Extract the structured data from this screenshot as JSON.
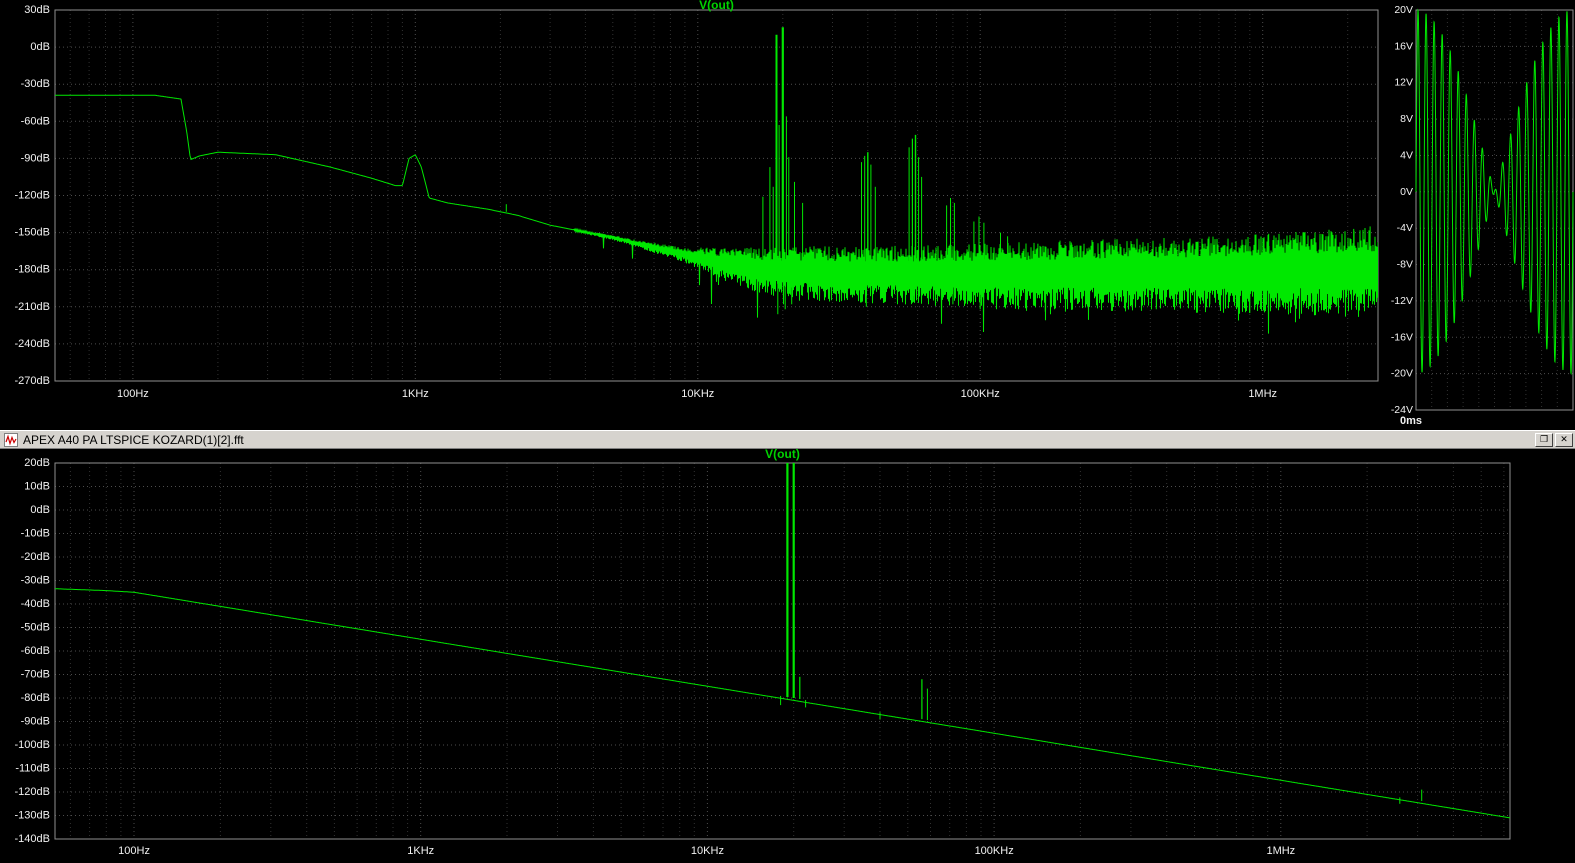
{
  "window": {
    "title": "APEX A40 PA LTSPICE KOZARD(1)[2].fft",
    "icon": "waveform-icon",
    "buttons": [
      {
        "name": "restore-button",
        "glyph": "❐"
      },
      {
        "name": "close-button",
        "glyph": "✕"
      }
    ]
  },
  "colors": {
    "background": "#000000",
    "trace": "#00e800",
    "title": "#00d400",
    "text": "#f2f2f2",
    "grid": "#4d4d4d",
    "grid_minor": "#323232",
    "frame": "#8f8f8f",
    "titlebar_bg": "#d6d3ce",
    "titlebar_text": "#000000",
    "icon_trace": "#cc0000"
  },
  "chart_data": [
    {
      "id": "top_fft",
      "type": "line",
      "title": "V(out)",
      "x_axis": {
        "scale": "log",
        "unit": "Hz",
        "min": 53,
        "max": 2560000,
        "ticks": [
          {
            "f": 100,
            "label": "100Hz"
          },
          {
            "f": 1000,
            "label": "1KHz"
          },
          {
            "f": 10000,
            "label": "10KHz"
          },
          {
            "f": 100000,
            "label": "100KHz"
          },
          {
            "f": 1000000,
            "label": "1MHz"
          }
        ]
      },
      "y_axis": {
        "unit": "dB",
        "min": -270,
        "max": 30,
        "ticks": [
          {
            "v": 30,
            "label": "30dB"
          },
          {
            "v": 0,
            "label": "0dB"
          },
          {
            "v": -30,
            "label": "-30dB"
          },
          {
            "v": -60,
            "label": "-60dB"
          },
          {
            "v": -90,
            "label": "-90dB"
          },
          {
            "v": -120,
            "label": "-120dB"
          },
          {
            "v": -150,
            "label": "-150dB"
          },
          {
            "v": -180,
            "label": "-180dB"
          },
          {
            "v": -210,
            "label": "-210dB"
          },
          {
            "v": -240,
            "label": "-240dB"
          },
          {
            "v": -270,
            "label": "-270dB"
          }
        ]
      },
      "baseline_points": [
        [
          53,
          -39
        ],
        [
          120,
          -39
        ],
        [
          148,
          -42
        ],
        [
          155,
          -68
        ],
        [
          160,
          -91
        ],
        [
          172,
          -88
        ],
        [
          200,
          -85
        ],
        [
          320,
          -87
        ],
        [
          500,
          -97
        ],
        [
          700,
          -106
        ],
        [
          850,
          -112
        ],
        [
          900,
          -112
        ],
        [
          950,
          -90
        ],
        [
          1000,
          -87
        ],
        [
          1050,
          -97
        ],
        [
          1120,
          -122
        ],
        [
          1300,
          -126
        ],
        [
          1800,
          -131
        ],
        [
          2300,
          -136
        ],
        [
          3000,
          -144
        ],
        [
          5000,
          -154
        ],
        [
          7000,
          -162
        ],
        [
          10000,
          -170
        ],
        [
          13000,
          -176
        ],
        [
          18000,
          -180
        ],
        [
          30000,
          -182
        ],
        [
          100000,
          -183
        ],
        [
          300000,
          -182
        ],
        [
          1000000,
          -181
        ],
        [
          2560000,
          -179
        ]
      ],
      "noise": {
        "seed": 1337,
        "down_spike_prob": 0.05,
        "down_spike_extra": 24,
        "spread_points": [
          [
            53,
            0
          ],
          [
            3000,
            0
          ],
          [
            4000,
            1.5
          ],
          [
            6000,
            3
          ],
          [
            9000,
            7
          ],
          [
            12000,
            14
          ],
          [
            16000,
            20
          ],
          [
            25000,
            24
          ],
          [
            60000,
            26
          ],
          [
            150000,
            30
          ],
          [
            500000,
            33
          ],
          [
            1200000,
            36
          ],
          [
            2560000,
            40
          ]
        ]
      },
      "peaks": [
        [
          2100,
          -127,
          1
        ],
        [
          17000,
          -121,
          1
        ],
        [
          18000,
          -97,
          1
        ],
        [
          18500,
          -113,
          1
        ],
        [
          19000,
          10,
          2
        ],
        [
          19400,
          -63,
          1
        ],
        [
          20000,
          16,
          2.2
        ],
        [
          20600,
          -56,
          1
        ],
        [
          21000,
          -89,
          1
        ],
        [
          22000,
          -109,
          1
        ],
        [
          23500,
          -126,
          1
        ],
        [
          38000,
          -93,
          1
        ],
        [
          39000,
          -88,
          1
        ],
        [
          40000,
          -85,
          1.4
        ],
        [
          41000,
          -95,
          1
        ],
        [
          42500,
          -113,
          1
        ],
        [
          56000,
          -81,
          1
        ],
        [
          57500,
          -74,
          1.2
        ],
        [
          59000,
          -71,
          1.4
        ],
        [
          60500,
          -89,
          1
        ],
        [
          62000,
          -105,
          1
        ],
        [
          76000,
          -128,
          1
        ],
        [
          78500,
          -122,
          1
        ],
        [
          81000,
          -126,
          1
        ],
        [
          95000,
          -141,
          1
        ],
        [
          99000,
          -137,
          1
        ],
        [
          103000,
          -142,
          1
        ],
        [
          118000,
          -150,
          1
        ],
        [
          125000,
          -153,
          1
        ],
        [
          160000,
          -159,
          1
        ],
        [
          210000,
          -158,
          1
        ],
        [
          1050000,
          -151,
          1
        ],
        [
          1400000,
          -150,
          1
        ],
        [
          2100000,
          -147,
          1
        ],
        [
          2400000,
          -145,
          1
        ]
      ],
      "down_spikes": [
        [
          19200,
          -216
        ],
        [
          20400,
          -212
        ],
        [
          21500,
          -208
        ],
        [
          39500,
          -210
        ],
        [
          58000,
          -206
        ],
        [
          80000,
          -208
        ],
        [
          100000,
          -212
        ],
        [
          130000,
          -207
        ],
        [
          170000,
          -214
        ],
        [
          260000,
          -209
        ],
        [
          420000,
          -212
        ],
        [
          650000,
          -208
        ],
        [
          900000,
          -215
        ],
        [
          1150000,
          -210
        ],
        [
          1500000,
          -214
        ],
        [
          1850000,
          -209
        ],
        [
          2200000,
          -213
        ],
        [
          2450000,
          -208
        ]
      ]
    },
    {
      "id": "scope",
      "type": "line",
      "title": "",
      "x_axis": {
        "unit": "ms",
        "min": 0,
        "max": 1,
        "label": "0ms",
        "grid_step_ms": 0.1
      },
      "y_axis": {
        "unit": "V",
        "min": -24,
        "max": 20,
        "ticks": [
          {
            "v": 20,
            "label": "20V"
          },
          {
            "v": 16,
            "label": "16V"
          },
          {
            "v": 12,
            "label": "12V"
          },
          {
            "v": 8,
            "label": "8V"
          },
          {
            "v": 4,
            "label": "4V"
          },
          {
            "v": 0,
            "label": "0V"
          },
          {
            "v": -4,
            "label": "-4V"
          },
          {
            "v": -8,
            "label": "-8V"
          },
          {
            "v": -12,
            "label": "-12V"
          },
          {
            "v": -16,
            "label": "-16V"
          },
          {
            "v": -20,
            "label": "-20V"
          },
          {
            "v": -24,
            "label": "-24V"
          }
        ]
      },
      "signal": {
        "components": [
          {
            "freq_hz": 19000,
            "amp_v": 10
          },
          {
            "freq_hz": 20000,
            "amp_v": 10
          }
        ]
      }
    },
    {
      "id": "bottom_fft",
      "type": "line",
      "title": "V(out)",
      "x_axis": {
        "scale": "log",
        "unit": "Hz",
        "min": 53,
        "max": 6300000,
        "ticks": [
          {
            "f": 100,
            "label": "100Hz"
          },
          {
            "f": 1000,
            "label": "1KHz"
          },
          {
            "f": 10000,
            "label": "10KHz"
          },
          {
            "f": 100000,
            "label": "100KHz"
          },
          {
            "f": 1000000,
            "label": "1MHz"
          }
        ]
      },
      "y_axis": {
        "unit": "dB",
        "min": -140,
        "max": 20,
        "ticks": [
          {
            "v": 20,
            "label": "20dB"
          },
          {
            "v": 10,
            "label": "10dB"
          },
          {
            "v": 0,
            "label": "0dB"
          },
          {
            "v": -10,
            "label": "-10dB"
          },
          {
            "v": -20,
            "label": "-20dB"
          },
          {
            "v": -30,
            "label": "-30dB"
          },
          {
            "v": -40,
            "label": "-40dB"
          },
          {
            "v": -50,
            "label": "-50dB"
          },
          {
            "v": -60,
            "label": "-60dB"
          },
          {
            "v": -70,
            "label": "-70dB"
          },
          {
            "v": -80,
            "label": "-80dB"
          },
          {
            "v": -90,
            "label": "-90dB"
          },
          {
            "v": -100,
            "label": "-100dB"
          },
          {
            "v": -110,
            "label": "-110dB"
          },
          {
            "v": -120,
            "label": "-120dB"
          },
          {
            "v": -130,
            "label": "-130dB"
          },
          {
            "v": -140,
            "label": "-140dB"
          }
        ]
      },
      "baseline_points": [
        [
          53,
          -33.5
        ],
        [
          80,
          -34.3
        ],
        [
          100,
          -35
        ],
        [
          1000,
          -55
        ],
        [
          10000,
          -75
        ],
        [
          100000,
          -95
        ],
        [
          1000000,
          -115
        ],
        [
          6300000,
          -131
        ]
      ],
      "peaks": [
        [
          18000,
          -83,
          1
        ],
        [
          19000,
          25,
          2.2
        ],
        [
          20000,
          25,
          2.2
        ],
        [
          21000,
          -71,
          1.2
        ],
        [
          22000,
          -84,
          1
        ],
        [
          40000,
          -89,
          1
        ],
        [
          56000,
          -72,
          1.2
        ],
        [
          58500,
          -76,
          1
        ],
        [
          2600000,
          -125,
          1
        ],
        [
          3100000,
          -119,
          1
        ]
      ],
      "down_spikes": []
    }
  ]
}
